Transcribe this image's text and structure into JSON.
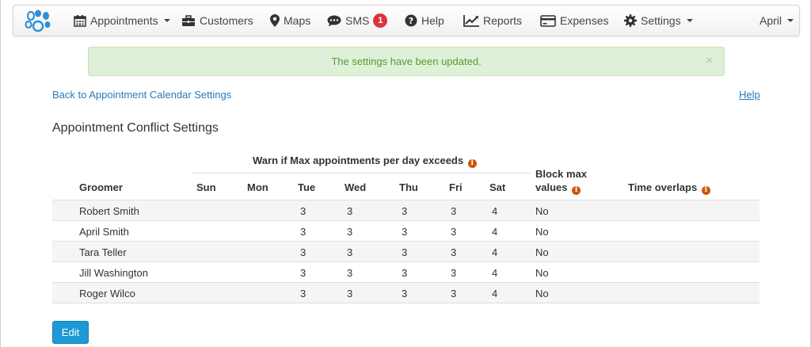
{
  "navbar": {
    "logo_icon": "paw-icon",
    "items": [
      {
        "label": "Appointments",
        "icon": "calendar-icon",
        "dropdown": true
      },
      {
        "label": "Customers",
        "icon": "briefcase-icon",
        "dropdown": false
      },
      {
        "label": "Maps",
        "icon": "map-marker-icon",
        "dropdown": false
      },
      {
        "label": "SMS",
        "icon": "comment-icon",
        "dropdown": false,
        "badge": "1"
      },
      {
        "label": "Help",
        "icon": "question-circle-icon",
        "dropdown": false
      },
      {
        "label": "Reports",
        "icon": "line-chart-icon",
        "dropdown": false
      },
      {
        "label": "Expenses",
        "icon": "credit-card-icon",
        "dropdown": false
      },
      {
        "label": "Settings",
        "icon": "cog-icon",
        "dropdown": true
      }
    ],
    "user": {
      "label": "April",
      "dropdown": true
    }
  },
  "alert": {
    "message": "The settings have been updated.",
    "close": "×",
    "colors": {
      "background": "#dff0d8",
      "text": "#5a9a3a"
    }
  },
  "links": {
    "back": "Back to Appointment Calendar Settings",
    "help": "Help"
  },
  "section": {
    "title": "Appointment Conflict Settings"
  },
  "table": {
    "group_header": "Warn if Max appointments per day exceeds",
    "columns": {
      "groomer": "Groomer",
      "days": [
        "Sun",
        "Mon",
        "Tue",
        "Wed",
        "Thu",
        "Fri",
        "Sat"
      ],
      "block_line1": "Block max",
      "block_line2": "values",
      "overlaps": "Time overlaps"
    },
    "info_icon": "info-circle-icon",
    "rows": [
      {
        "groomer": "Robert Smith",
        "days": [
          "",
          "",
          "3",
          "3",
          "3",
          "3",
          "4"
        ],
        "block": "No",
        "overlaps": ""
      },
      {
        "groomer": "April Smith",
        "days": [
          "",
          "",
          "3",
          "3",
          "3",
          "3",
          "4"
        ],
        "block": "No",
        "overlaps": ""
      },
      {
        "groomer": "Tara Teller",
        "days": [
          "",
          "",
          "3",
          "3",
          "3",
          "3",
          "4"
        ],
        "block": "No",
        "overlaps": ""
      },
      {
        "groomer": "Jill Washington",
        "days": [
          "",
          "",
          "3",
          "3",
          "3",
          "3",
          "4"
        ],
        "block": "No",
        "overlaps": ""
      },
      {
        "groomer": "Roger Wilco",
        "days": [
          "",
          "",
          "3",
          "3",
          "3",
          "3",
          "4"
        ],
        "block": "No",
        "overlaps": ""
      }
    ]
  },
  "actions": {
    "edit": "Edit",
    "edit_color": "#1d9ad6"
  }
}
